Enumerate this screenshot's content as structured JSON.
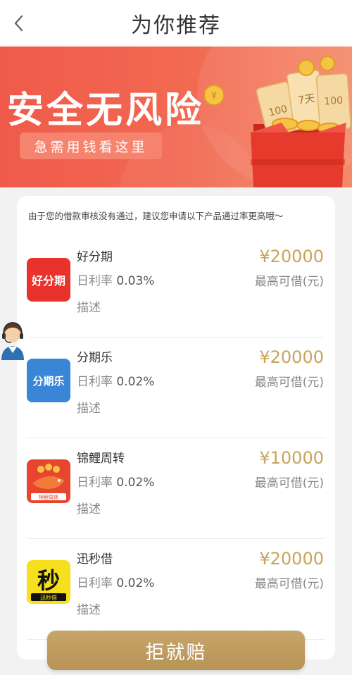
{
  "header": {
    "title": "为你推荐",
    "back_icon": "chevron-left-icon"
  },
  "banner": {
    "title": "安全无风险",
    "subtitle": "急需用钱看这里",
    "ticket_labels": [
      "100",
      "7天",
      "100"
    ]
  },
  "notice": "由于您的借款审核没有通过，建议您申请以下产品通过率更高哦～",
  "products": [
    {
      "name": "好分期",
      "rate_label": "日利率",
      "rate": "0.03%",
      "desc": "描述",
      "amount": "¥20000",
      "amount_label": "最高可借(元)",
      "logo_text": "好分期"
    },
    {
      "name": "分期乐",
      "rate_label": "日利率",
      "rate": "0.02%",
      "desc": "描述",
      "amount": "¥20000",
      "amount_label": "最高可借(元)",
      "logo_text": "分期乐"
    },
    {
      "name": "锦鲤周转",
      "rate_label": "日利率",
      "rate": "0.02%",
      "desc": "描述",
      "amount": "¥10000",
      "amount_label": "最高可借(元)",
      "logo_text": "锦鲤周转"
    },
    {
      "name": "迅秒借",
      "rate_label": "日利率",
      "rate": "0.02%",
      "desc": "描述",
      "amount": "¥20000",
      "amount_label": "最高可借(元)",
      "logo_text": "秒",
      "logo_sub": "迅秒借"
    }
  ],
  "footer": {
    "button": "拒就赔"
  },
  "colors": {
    "accent_gold": "#c9a35a",
    "banner_red": "#f05a4a",
    "button_gold": "#bf9c60"
  }
}
